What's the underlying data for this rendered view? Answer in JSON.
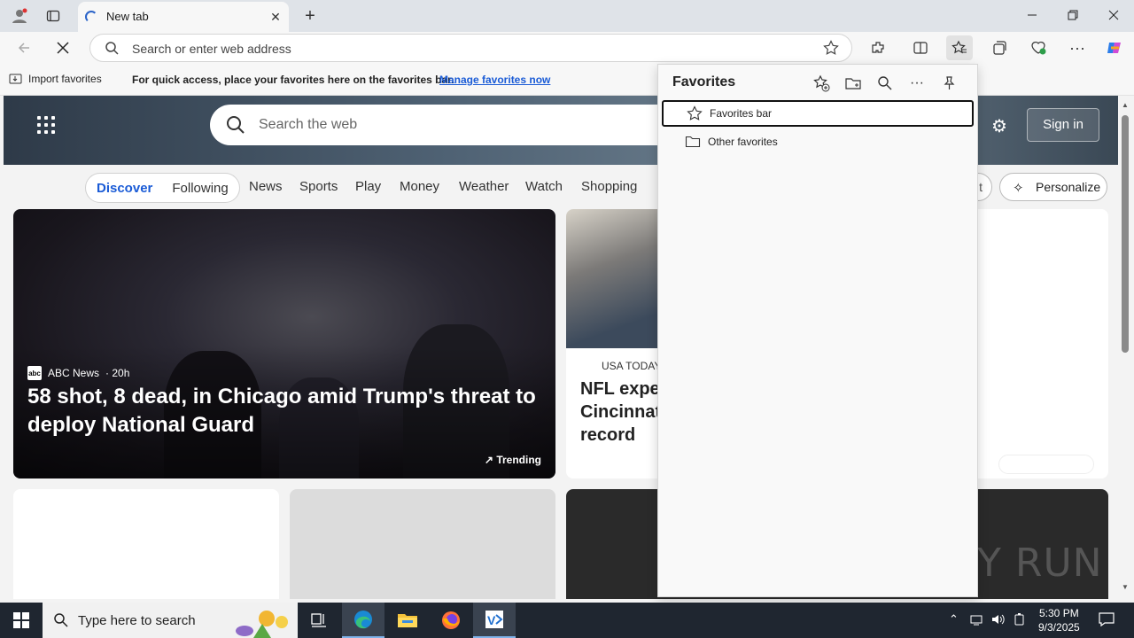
{
  "browser": {
    "tab_title": "New tab",
    "address_placeholder": "Search or enter web address"
  },
  "favorites_bar": {
    "import_label": "Import favorites",
    "hint": "For quick access, place your favorites here on the favorites bar.",
    "manage_link": "Manage favorites now"
  },
  "page": {
    "search_placeholder": "Search the web",
    "sign_in": "Sign in",
    "pills": [
      "Discover",
      "Following"
    ],
    "nav": [
      "News",
      "Sports",
      "Play",
      "Money",
      "Weather",
      "Watch",
      "Shopping"
    ],
    "hidden_pill_suffix": "t",
    "personalize": "Personalize",
    "main_card": {
      "source": "ABC News",
      "age": "· 20h",
      "source_logo": "abc",
      "headline": "58 shot, 8 dead, in Chicago amid Trump's threat to deploy National Guard",
      "badge": "Trending"
    },
    "card2": {
      "source": "USA TODAY",
      "headline_lines": [
        "NFL exper",
        "Cincinnati",
        "record"
      ]
    }
  },
  "favorites_panel": {
    "title": "Favorites",
    "items": [
      {
        "label": "Favorites bar",
        "icon": "star-icon"
      },
      {
        "label": "Other favorites",
        "icon": "folder-icon"
      }
    ]
  },
  "taskbar": {
    "search_placeholder": "Type here to search",
    "time": "5:30 PM",
    "date": "9/3/2025"
  },
  "watermark": "ANY RUN",
  "colors": {
    "accent": "#1a5bd6",
    "taskbar": "#1f2630",
    "titlebar": "#dfe3e8"
  }
}
